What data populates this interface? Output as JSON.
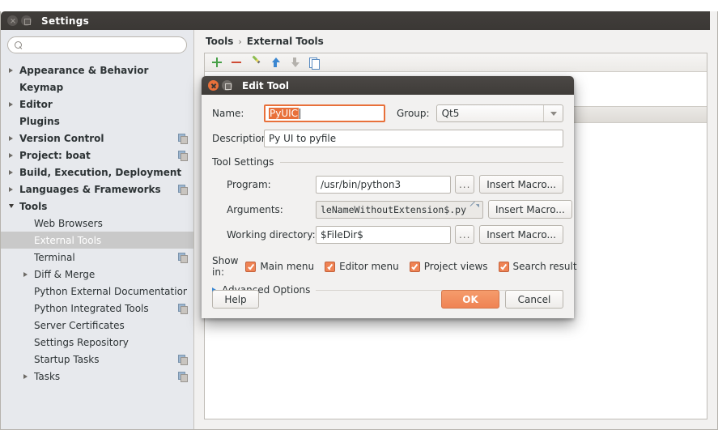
{
  "window": {
    "title": "Settings",
    "close_icon": "close-icon",
    "maximize_icon": "maximize-icon"
  },
  "sidebar": {
    "search": {
      "placeholder": "",
      "value": "",
      "icon": "search-icon"
    },
    "items": [
      {
        "label": "Appearance & Behavior",
        "depth": 1,
        "bold": true,
        "twisty": "right",
        "copy": false,
        "selected": false
      },
      {
        "label": "Keymap",
        "depth": 1,
        "bold": true,
        "twisty": "none",
        "copy": false,
        "selected": false
      },
      {
        "label": "Editor",
        "depth": 1,
        "bold": true,
        "twisty": "right",
        "copy": false,
        "selected": false
      },
      {
        "label": "Plugins",
        "depth": 1,
        "bold": true,
        "twisty": "none",
        "copy": false,
        "selected": false
      },
      {
        "label": "Version Control",
        "depth": 1,
        "bold": true,
        "twisty": "right",
        "copy": true,
        "selected": false
      },
      {
        "label": "Project: boat",
        "depth": 1,
        "bold": true,
        "twisty": "right",
        "copy": true,
        "selected": false
      },
      {
        "label": "Build, Execution, Deployment",
        "depth": 1,
        "bold": true,
        "twisty": "right",
        "copy": false,
        "selected": false
      },
      {
        "label": "Languages & Frameworks",
        "depth": 1,
        "bold": true,
        "twisty": "right",
        "copy": true,
        "selected": false
      },
      {
        "label": "Tools",
        "depth": 1,
        "bold": true,
        "twisty": "down",
        "copy": false,
        "selected": false
      },
      {
        "label": "Web Browsers",
        "depth": 2,
        "bold": false,
        "twisty": "none",
        "copy": false,
        "selected": false
      },
      {
        "label": "External Tools",
        "depth": 2,
        "bold": false,
        "twisty": "none",
        "copy": false,
        "selected": true
      },
      {
        "label": "Terminal",
        "depth": 2,
        "bold": false,
        "twisty": "none",
        "copy": true,
        "selected": false
      },
      {
        "label": "Diff & Merge",
        "depth": 2,
        "bold": false,
        "twisty": "right",
        "copy": false,
        "selected": false
      },
      {
        "label": "Python External Documentation",
        "depth": 2,
        "bold": false,
        "twisty": "none",
        "copy": false,
        "selected": false
      },
      {
        "label": "Python Integrated Tools",
        "depth": 2,
        "bold": false,
        "twisty": "none",
        "copy": true,
        "selected": false
      },
      {
        "label": "Server Certificates",
        "depth": 2,
        "bold": false,
        "twisty": "none",
        "copy": false,
        "selected": false
      },
      {
        "label": "Settings Repository",
        "depth": 2,
        "bold": false,
        "twisty": "none",
        "copy": false,
        "selected": false
      },
      {
        "label": "Startup Tasks",
        "depth": 2,
        "bold": false,
        "twisty": "none",
        "copy": true,
        "selected": false
      },
      {
        "label": "Tasks",
        "depth": 2,
        "bold": false,
        "twisty": "right",
        "copy": true,
        "selected": false
      }
    ]
  },
  "main": {
    "breadcrumb": {
      "parent": "Tools",
      "separator": "›",
      "current": "External Tools"
    },
    "toolbar": [
      {
        "name": "add-icon",
        "title": "Add"
      },
      {
        "name": "remove-icon",
        "title": "Remove"
      },
      {
        "name": "edit-pencil-icon",
        "title": "Edit"
      },
      {
        "name": "move-up-icon",
        "title": "Move Up"
      },
      {
        "name": "move-down-icon",
        "title": "Move Down"
      },
      {
        "name": "copy-icon",
        "title": "Copy"
      }
    ]
  },
  "dialog": {
    "title": "Edit Tool",
    "close_icon": "close-icon",
    "maximize_icon": "maximize-icon",
    "name": {
      "label": "Name:",
      "value": "PyUIC",
      "selected": true
    },
    "group": {
      "label": "Group:",
      "value": "Qt5",
      "arrow_icon": "chevron-down-icon"
    },
    "description": {
      "label": "Description:",
      "value": "Py UI to pyfile"
    },
    "tool_settings": {
      "legend": "Tool Settings",
      "fields": [
        {
          "label": "Program:",
          "value": "/usr/bin/python3",
          "mono": false,
          "browse": "...",
          "has_browse": true,
          "has_expand": false,
          "macro": "Insert Macro..."
        },
        {
          "label": "Arguments:",
          "value": "leNameWithoutExtension$.py",
          "mono": true,
          "browse": "",
          "has_browse": false,
          "has_expand": true,
          "macro": "Insert Macro..."
        },
        {
          "label": "Working directory:",
          "value": "$FileDir$",
          "mono": false,
          "browse": "...",
          "has_browse": true,
          "has_expand": false,
          "macro": "Insert Macro..."
        }
      ]
    },
    "show_in": {
      "label": "Show in:",
      "options": [
        {
          "label": "Main menu",
          "checked": true
        },
        {
          "label": "Editor menu",
          "checked": true
        },
        {
          "label": "Project views",
          "checked": true
        },
        {
          "label": "Search result",
          "checked": true
        }
      ]
    },
    "advanced_options": {
      "label": "Advanced Options",
      "expanded": false,
      "icon": "chevron-right-icon"
    },
    "buttons": {
      "help": "Help",
      "ok": "OK",
      "cancel": "Cancel"
    }
  },
  "colors": {
    "accent_orange": "#ef8354",
    "titlebar_dark": "#3f3c39",
    "sidebar_bg": "#e7e9ed",
    "panel_bg": "#f2f1f0",
    "selection_gray": "#c9c9c9"
  }
}
